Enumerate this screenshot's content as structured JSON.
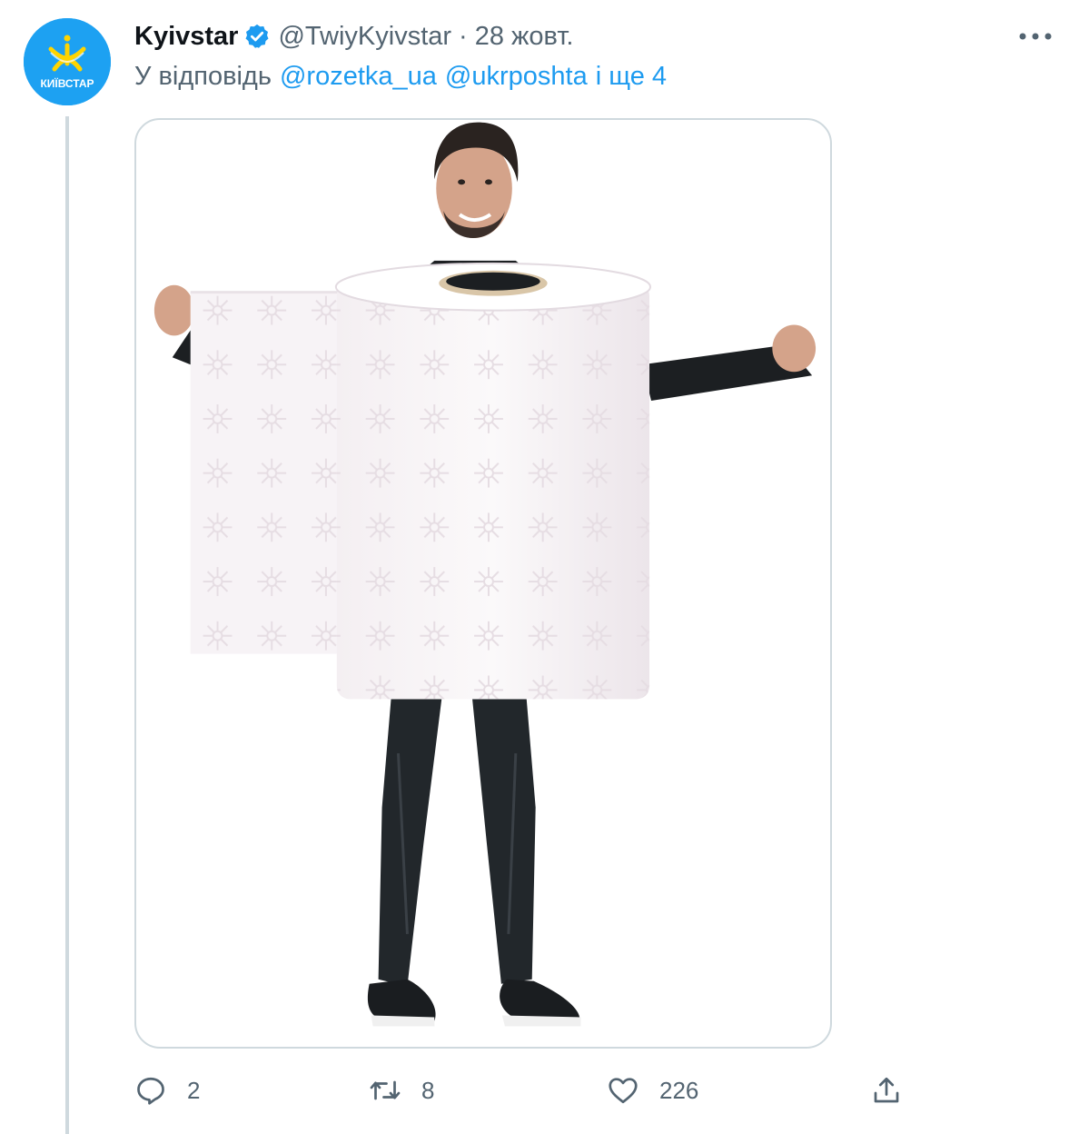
{
  "tweet": {
    "author": {
      "display_name": "Kyivstar",
      "handle": "@TwiyKyivstar",
      "verified": true,
      "avatar_label": "КИЇВСТАР"
    },
    "separator": "·",
    "timestamp": "28 жовт.",
    "reply_prefix": "У відповідь",
    "mentions": [
      "@rozetka_ua",
      "@ukrposhta"
    ],
    "reply_suffix": "і ще 4",
    "media": {
      "kind": "photo",
      "description_icon": "photo-icon"
    },
    "actions": {
      "reply_count": "2",
      "retweet_count": "8",
      "like_count": "226"
    }
  },
  "colors": {
    "accent": "#1d9bf0",
    "secondary_text": "#536471",
    "border": "#cfd9de",
    "brand_yellow": "#ffd400"
  }
}
